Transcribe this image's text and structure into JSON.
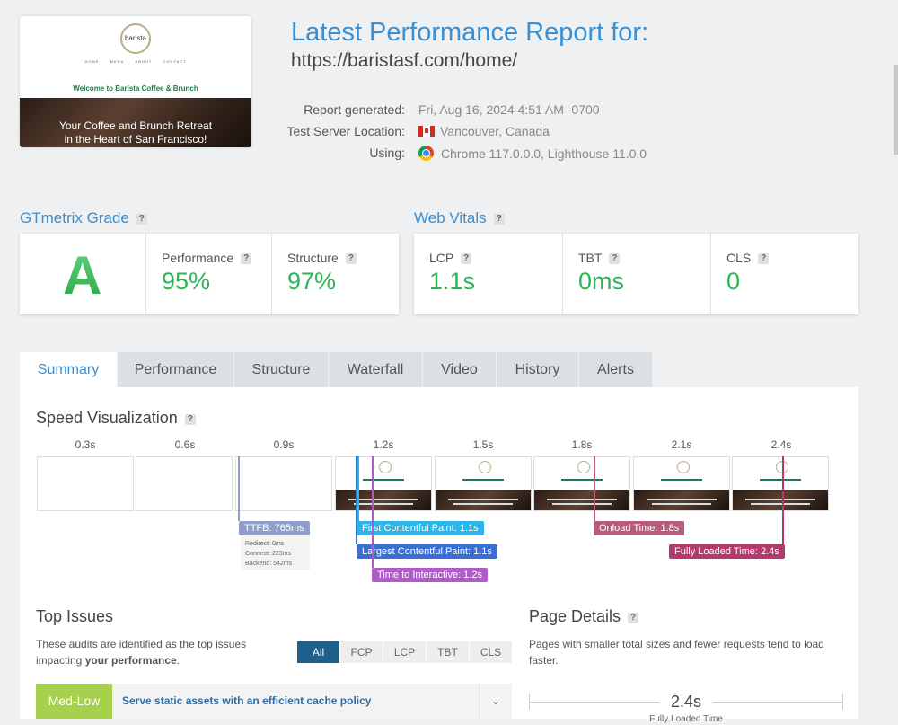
{
  "thumbnail": {
    "logo_text": "barista",
    "nav": [
      "HOME",
      "MENU",
      "ABOUT",
      "CONTACT"
    ],
    "welcome": "Welcome to Barista Coffee & Brunch",
    "hero_line1": "Your Coffee and Brunch Retreat",
    "hero_line2": "in the Heart of San Francisco!"
  },
  "report": {
    "title": "Latest Performance Report for:",
    "url": "https://baristasf.com/home/",
    "generated_label": "Report generated:",
    "generated_value": "Fri, Aug 16, 2024 4:51 AM -0700",
    "server_label": "Test Server Location:",
    "server_value": "Vancouver, Canada",
    "using_label": "Using:",
    "using_value": "Chrome 117.0.0.0, Lighthouse 11.0.0"
  },
  "grade": {
    "heading": "GTmetrix Grade",
    "letter": "A",
    "performance_label": "Performance",
    "performance_value": "95%",
    "structure_label": "Structure",
    "structure_value": "97%"
  },
  "vitals": {
    "heading": "Web Vitals",
    "lcp_label": "LCP",
    "lcp_value": "1.1s",
    "tbt_label": "TBT",
    "tbt_value": "0ms",
    "cls_label": "CLS",
    "cls_value": "0"
  },
  "tabs": [
    "Summary",
    "Performance",
    "Structure",
    "Waterfall",
    "Video",
    "History",
    "Alerts"
  ],
  "speed": {
    "title": "Speed Visualization",
    "times": [
      "0.3s",
      "0.6s",
      "0.9s",
      "1.2s",
      "1.5s",
      "1.8s",
      "2.1s",
      "2.4s"
    ],
    "ttfb": "TTFB: 765ms",
    "redirect": "Redirect: 0ms",
    "connect": "Connect: 223ms",
    "backend": "Backend: 542ms",
    "fcp": "First Contentful Paint: 1.1s",
    "lcp": "Largest Contentful Paint: 1.1s",
    "tti": "Time to Interactive: 1.2s",
    "onload": "Onload Time: 1.8s",
    "fully_loaded": "Fully Loaded Time: 2.4s"
  },
  "issues": {
    "title": "Top Issues",
    "desc_line1": "These audits are identified as the top issues",
    "desc_line2_prefix": "impacting ",
    "desc_line2_bold": "your performance",
    "desc_line2_suffix": ".",
    "filters": [
      "All",
      "FCP",
      "LCP",
      "TBT",
      "CLS"
    ],
    "first_badge": "Med-Low",
    "first_text": "Serve static assets with an efficient cache policy"
  },
  "page_details": {
    "title": "Page Details",
    "desc": "Pages with smaller total sizes and fewer requests tend to load faster.",
    "fully_loaded_value": "2.4s",
    "fully_loaded_label": "Fully Loaded Time"
  },
  "colors": {
    "accent": "#3a8fd1",
    "good": "#30b257",
    "ttfb": "#8f9fc9",
    "fcp": "#2ab6e8",
    "lcp": "#3a6fd1",
    "tti": "#b05cc8",
    "onload": "#b85a7c",
    "fully_loaded": "#b23a6c",
    "badge_medlow": "#a7d04d"
  }
}
